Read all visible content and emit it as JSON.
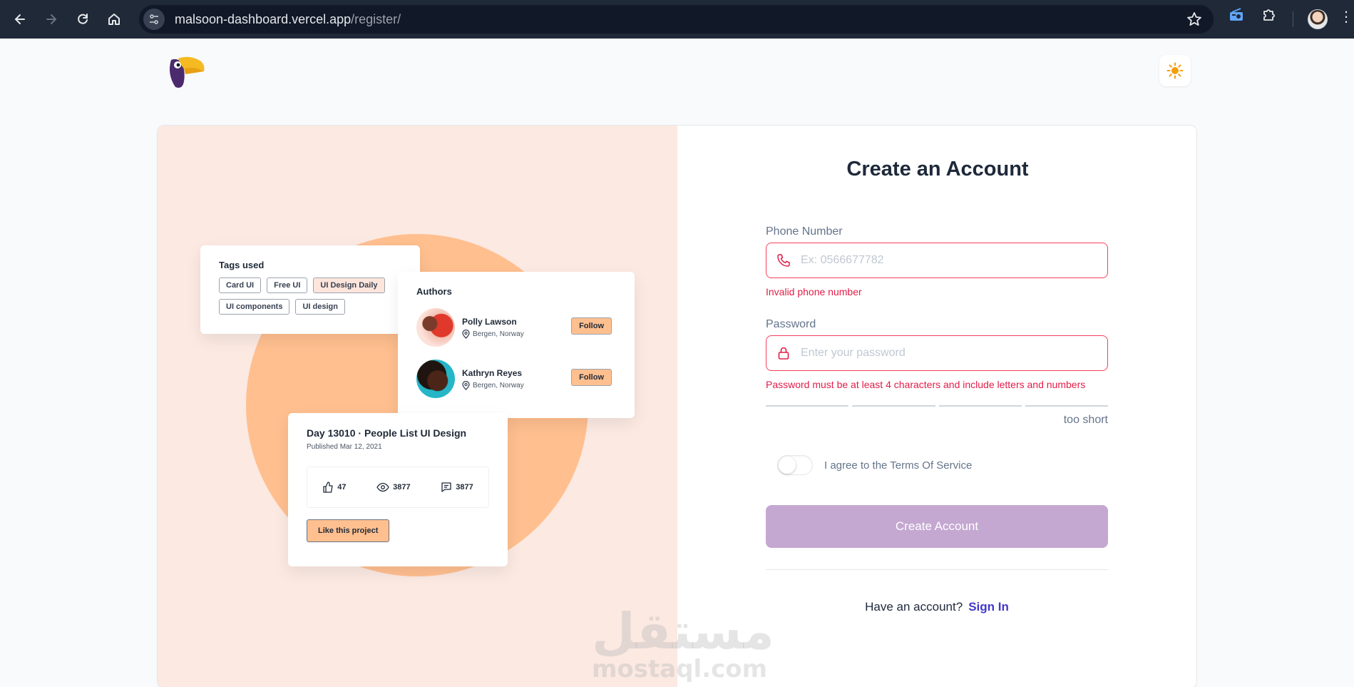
{
  "browser": {
    "url_host": "malsoon-dashboard.vercel.app",
    "url_path": "/register/"
  },
  "illustration": {
    "tags_title": "Tags used",
    "tags": [
      {
        "label": "Card UI",
        "active": false
      },
      {
        "label": "Free UI",
        "active": false
      },
      {
        "label": "UI Design Daily",
        "active": true
      },
      {
        "label": "UI components",
        "active": false
      },
      {
        "label": "UI design",
        "active": false
      }
    ],
    "authors_title": "Authors",
    "authors": [
      {
        "name": "Polly Lawson",
        "location": "Bergen, Norway",
        "follow": "Follow"
      },
      {
        "name": "Kathryn Reyes",
        "location": "Bergen, Norway",
        "follow": "Follow"
      }
    ],
    "project": {
      "title": "Day 13010 · People List UI Design",
      "published": "Published Mar 12, 2021",
      "likes": "47",
      "views": "3877",
      "comments": "3877",
      "like_button": "Like this project"
    }
  },
  "form": {
    "title": "Create an Account",
    "phone": {
      "label": "Phone Number",
      "placeholder": "Ex: 0566677782",
      "value": "",
      "error": "Invalid phone number"
    },
    "password": {
      "label": "Password",
      "placeholder": "Enter your password",
      "value": "",
      "error": "Password must be at least 4 characters and include letters and numbers",
      "strength_label": "too short"
    },
    "terms": {
      "label": "I agree to the Terms Of Service",
      "checked": false
    },
    "submit_label": "Create Account",
    "signin_prompt": "Have an account?",
    "signin_link": "Sign In"
  },
  "watermark": {
    "arabic": "مستقل",
    "latin": "mostaql.com"
  },
  "colors": {
    "accent": "#4338ca",
    "error": "#e11d48",
    "button_disabled": "#c4a8d1",
    "illustration_bg": "#fbe9e2",
    "illustration_circle": "#ffbf8f"
  }
}
